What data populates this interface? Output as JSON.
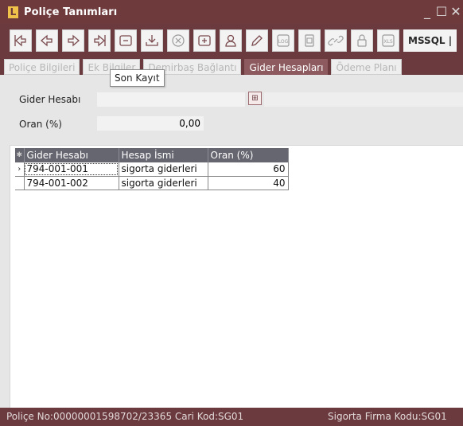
{
  "window": {
    "logo_letter": "L",
    "title": "Poliçe Tanımları",
    "controls": {
      "minimize": "_",
      "maximize": "☐",
      "close": "✕"
    }
  },
  "toolbar": {
    "buttons": [
      "first-record-icon",
      "previous-record-icon",
      "next-record-icon",
      "last-record-icon",
      "list-icon",
      "download-icon",
      "cancel-icon",
      "add-icon",
      "user-icon",
      "edit-icon",
      "log-icon",
      "document-icon",
      "link-icon",
      "lock-icon",
      "xls-icon"
    ],
    "db_label": "MSSQL |"
  },
  "tabs": [
    {
      "label": "Poliçe Bilgileri",
      "active": false
    },
    {
      "label": "Ek Bilgiler",
      "active": false
    },
    {
      "label": "Demirbaş Bağlantı",
      "active": false
    },
    {
      "label": "Gider Hesapları",
      "active": true
    },
    {
      "label": "Ödeme Planı",
      "active": false
    }
  ],
  "tooltip": "Son Kayıt",
  "form": {
    "gider_hesabi_label": "Gider Hesabı",
    "gider_hesabi_value": "",
    "oran_label": "Oran (%)",
    "oran_value": "0,00"
  },
  "grid": {
    "indicator_header": "✱",
    "columns": [
      "Gider Hesabı",
      "Hesap İsmi",
      "Oran (%)"
    ],
    "rows": [
      {
        "indicator": "›",
        "gider_hesabi": "794-001-001",
        "hesap_ismi": "sigorta giderleri",
        "oran": "60"
      },
      {
        "indicator": "",
        "gider_hesabi": "794-001-002",
        "hesap_ismi": "sigorta giderleri",
        "oran": "40"
      }
    ]
  },
  "status": {
    "left": "Poliçe No:00000001598702/23365  Cari Kod:SG01",
    "right": "Sigorta Firma Kodu:SG01"
  }
}
